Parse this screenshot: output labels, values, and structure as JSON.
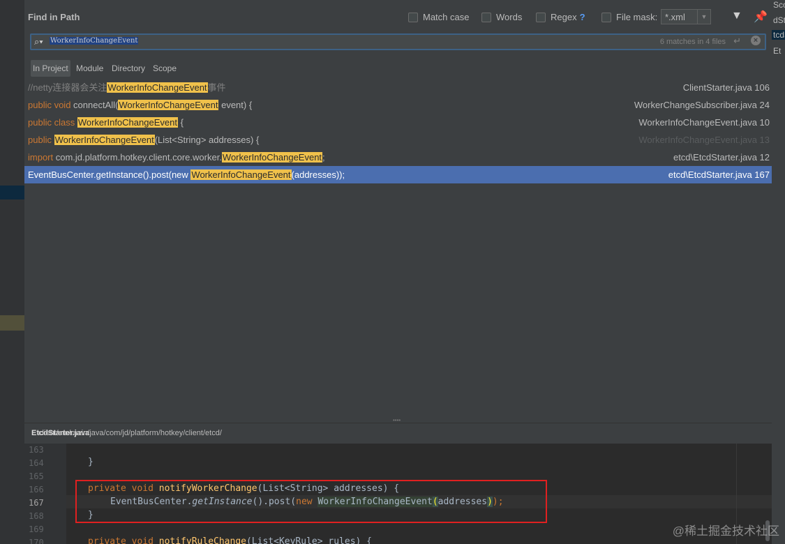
{
  "dialog": {
    "title": "Find in Path",
    "options": {
      "match_case": "Match case",
      "words": "Words",
      "regex": "Regex",
      "regex_help": "?",
      "file_mask": "File mask:",
      "file_mask_value": "*.xml"
    },
    "search": {
      "query": "WorkerInfoChangeEvent",
      "match_count": "6 matches in 4 files"
    },
    "scopes": [
      "In Project",
      "Module",
      "Directory",
      "Scope"
    ],
    "selected_scope": "In Project"
  },
  "results": [
    {
      "before": "//netty连接器会关注",
      "match": "WorkerInfoChangeEvent",
      "after": "事件",
      "file": "ClientStarter.java 106"
    },
    {
      "kw": "public void",
      "before": " connectAll(",
      "match": "WorkerInfoChangeEvent",
      "after": " event) {",
      "file": "WorkerChangeSubscriber.java 24"
    },
    {
      "kw": "public class",
      "before": " ",
      "match": "WorkerInfoChangeEvent",
      "after": " {",
      "file": "WorkerInfoChangeEvent.java 10"
    },
    {
      "kw": "public",
      "before": " ",
      "match": "WorkerInfoChangeEvent",
      "after": "(List<String> addresses) {",
      "file": "WorkerInfoChangeEvent.java 13"
    },
    {
      "kw": "import",
      "before": " com.jd.platform.hotkey.client.core.worker.",
      "match": "WorkerInfoChangeEvent",
      "after": ";",
      "file": "etcd\\EtcdStarter.java 12"
    },
    {
      "before": "EventBusCenter.getInstance().post(new ",
      "match": "WorkerInfoChangeEvent",
      "after": "(addresses));",
      "file": "etcd\\EtcdStarter.java 167"
    }
  ],
  "preview": {
    "path_prefix": "client/src/main/java/com/jd/platform/hotkey/client/etcd/",
    "path_file": "EtcdStarter.java",
    "line_numbers": [
      "163",
      "164",
      "165",
      "166",
      "167",
      "168",
      "169",
      "170"
    ],
    "lines": {
      "l164": "}",
      "l166_kw": "private void ",
      "l166_fn": "notifyWorkerChange",
      "l166_rest": "(List<String> addresses) {",
      "l167_a": "EventBusCenter.",
      "l167_b": "getInstance",
      "l167_c": "().post(",
      "l167_kw": "new ",
      "l167_ev": "WorkerInfoChangeEvent",
      "l167_p1": "(",
      "l167_args": "addresses",
      "l167_p2": ")",
      "l167_end": ");",
      "l168": "}",
      "l170_kw": "private void ",
      "l170_fn": "notifyRuleChange",
      "l170_rest": "(List<KeyRule> rules) {"
    }
  },
  "background": {
    "right_labels": [
      "Sco",
      "dSta",
      "tcdS",
      "Et"
    ]
  },
  "watermark": "@稀土掘金技术社区",
  "colors": {
    "dialog_bg": "#3c3f41",
    "selection": "#4b6eaf",
    "match_highlight": "#f0c14b",
    "keyword": "#cc7832",
    "annotation_box": "#e02020"
  }
}
